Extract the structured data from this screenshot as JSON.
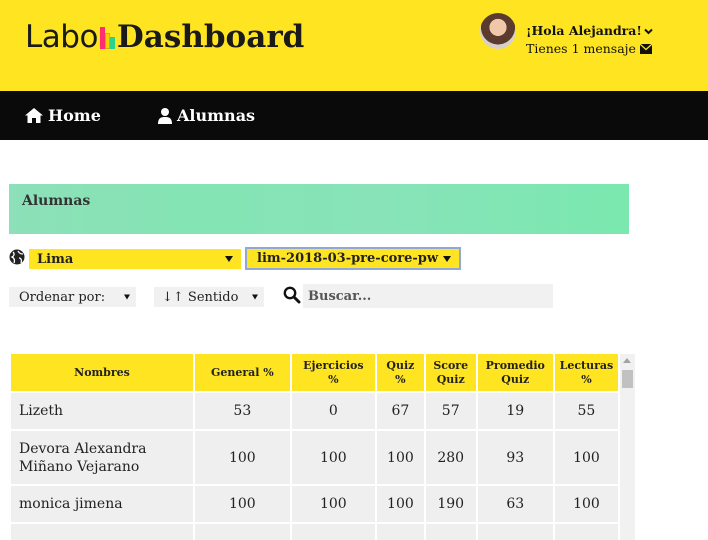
{
  "header": {
    "logo_left": "Labo",
    "logo_right": "Dashboard",
    "logo_bar_colors": [
      "#ff2e6e",
      "#ffd000",
      "#2ad38b"
    ],
    "greeting": "¡Hola Alejandra!",
    "messages": "Tienes 1 mensaje",
    "caret_icon": "chevron-down-icon",
    "message_icon": "envelope-icon"
  },
  "nav": {
    "home_label": "Home",
    "home_icon": "home-icon",
    "students_label": "Alumnas",
    "students_icon": "user-icon"
  },
  "section": {
    "title": "Alumnas"
  },
  "filters": {
    "city": "Lima",
    "cohort": "lim-2018-03-pre-core-pw",
    "order_label": "Ordenar por:",
    "direction_label": "↓↑ Sentido",
    "search_placeholder": "Buscar..."
  },
  "table": {
    "headers": [
      "Nombres",
      "General %",
      "Ejercicios %",
      "Quiz %",
      "Score Quiz",
      "Promedio Quiz",
      "Lecturas %"
    ],
    "headers_lines": [
      [
        "Nombres"
      ],
      [
        "General %"
      ],
      [
        "Ejercicios",
        "%"
      ],
      [
        "Quiz",
        "%"
      ],
      [
        "Score",
        "Quiz"
      ],
      [
        "Promedio",
        "Quiz"
      ],
      [
        "Lecturas",
        "%"
      ]
    ],
    "rows": [
      {
        "name": "Lizeth",
        "general": "53",
        "ejercicios": "0",
        "quiz": "67",
        "score": "57",
        "promedio": "19",
        "lecturas": "55"
      },
      {
        "name": "Devora Alexandra Miñano Vejarano",
        "general": "100",
        "ejercicios": "100",
        "quiz": "100",
        "score": "280",
        "promedio": "93",
        "lecturas": "100"
      },
      {
        "name": "monica jimena",
        "general": "100",
        "ejercicios": "100",
        "quiz": "100",
        "score": "190",
        "promedio": "63",
        "lecturas": "100"
      }
    ]
  },
  "colors": {
    "brand_yellow": "#ffe521",
    "nav_black": "#0a0a0a",
    "banner_green": "#84e4b3"
  }
}
